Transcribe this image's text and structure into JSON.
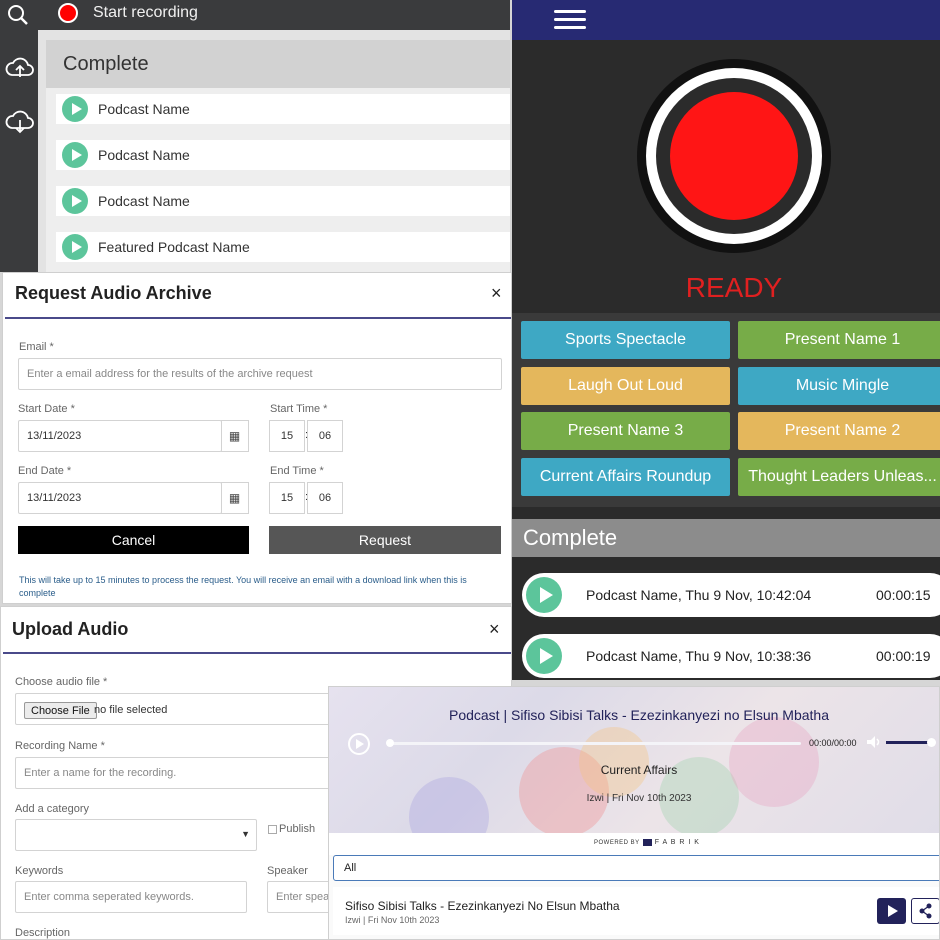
{
  "recorder": {
    "start_label": "Start recording",
    "list_title": "Complete",
    "items": [
      "Podcast Name",
      "Podcast Name",
      "Podcast Name",
      "Featured Podcast Name"
    ]
  },
  "archive_modal": {
    "title": "Request Audio Archive",
    "close": "×",
    "email_label": "Email *",
    "email_placeholder": "Enter a email address for the results of the archive request",
    "start_date_label": "Start Date *",
    "start_date": "13/11/2023",
    "start_time_label": "Start Time *",
    "start_hour": "15",
    "start_minute": "06",
    "end_date_label": "End Date *",
    "end_date": "13/11/2023",
    "end_time_label": "End Time *",
    "end_hour": "15",
    "end_minute": "06",
    "cancel": "Cancel",
    "request": "Request",
    "note": "This will take up to 15 minutes to process the request. You will receive an email with a download link when this is complete"
  },
  "upload_modal": {
    "title": "Upload Audio",
    "close": "×",
    "file_label": "Choose audio file *",
    "choose_btn": "Choose File",
    "no_file": "no file selected",
    "recording_label": "Recording Name *",
    "recording_placeholder": "Enter a name for the recording.",
    "category_label": "Add a category",
    "publish_label": "Publish",
    "keywords_label": "Keywords",
    "keywords_placeholder": "Enter comma seperated keywords.",
    "speaker_label": "Speaker",
    "speaker_placeholder": "Enter spea",
    "description_label": "Description"
  },
  "live_panel": {
    "status": "READY",
    "tiles": [
      {
        "label": "Sports Spectacle",
        "color": "#3ea8c4"
      },
      {
        "label": "Present Name 1",
        "color": "#77ac48"
      },
      {
        "label": "Laugh Out Loud",
        "color": "#e4b75c"
      },
      {
        "label": "Music Mingle",
        "color": "#3ea8c4"
      },
      {
        "label": "Present Name 3",
        "color": "#77ac48"
      },
      {
        "label": "Present Name 2",
        "color": "#e4b75c"
      },
      {
        "label": "Current Affairs Roundup",
        "color": "#3ea8c4"
      },
      {
        "label": "Thought Leaders Unleas...",
        "color": "#77ac48"
      }
    ],
    "complete_title": "Complete",
    "recordings": [
      {
        "name": "Podcast Name, Thu 9 Nov, 10:42:04",
        "duration": "00:00:15"
      },
      {
        "name": "Podcast Name, Thu 9 Nov, 10:38:36",
        "duration": "00:00:19"
      }
    ]
  },
  "player": {
    "title": "Podcast | Sifiso Sibisi Talks - Ezezinkanyezi no Elsun Mbatha",
    "time": "00:00/00:00",
    "category": "Current Affairs",
    "meta": "Izwi | Fri Nov 10th 2023",
    "powered_by": "POWERED BY",
    "brand": "F A B R I K",
    "filter_value": "All",
    "episode_title": "Sifiso Sibisi Talks - Ezezinkanyezi No Elsun Mbatha",
    "episode_meta": "Izwi | Fri Nov 10th 2023"
  },
  "colors": {
    "accent_green": "#5cc59b",
    "record_red": "#ff0000",
    "nav_blue": "#272a73"
  }
}
